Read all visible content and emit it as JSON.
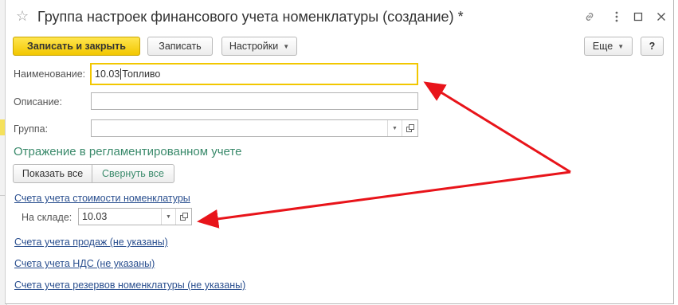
{
  "window": {
    "title": "Группа настроек финансового учета номенклатуры (создание) *"
  },
  "icons": [
    "star-icon",
    "link-icon",
    "more-vert-icon",
    "maximize-icon",
    "close-icon",
    "chevron-down-icon",
    "open-form-icon"
  ],
  "colors": {
    "accent_yellow": "#f2c700",
    "section_green": "#3a8a6b",
    "link_blue": "#2a4f8f",
    "arrow_red": "#e8141a"
  },
  "toolbar": {
    "save_close_label": "Записать и закрыть",
    "save_label": "Записать",
    "settings_label": "Настройки",
    "more_label": "Еще",
    "help_label": "?"
  },
  "form": {
    "name_label": "Наименование:",
    "name_value_prefix": "10.03",
    "name_value_suffix": "Топливо",
    "description_label": "Описание:",
    "description_value": "",
    "group_label": "Группа:",
    "group_value": ""
  },
  "section": {
    "title": "Отражение в регламентированном учете",
    "show_all_label": "Показать все",
    "collapse_all_label": "Свернуть все"
  },
  "accounts": {
    "cost_link": "Счета учета стоимости номенклатуры",
    "warehouse_label": "На складе:",
    "warehouse_value": "10.03",
    "sales_link": "Счета учета продаж (не указаны)",
    "vat_link": "Счета учета НДС (не указаны)",
    "reserves_link": "Счета учета резервов номенклатуры (не указаны)"
  }
}
